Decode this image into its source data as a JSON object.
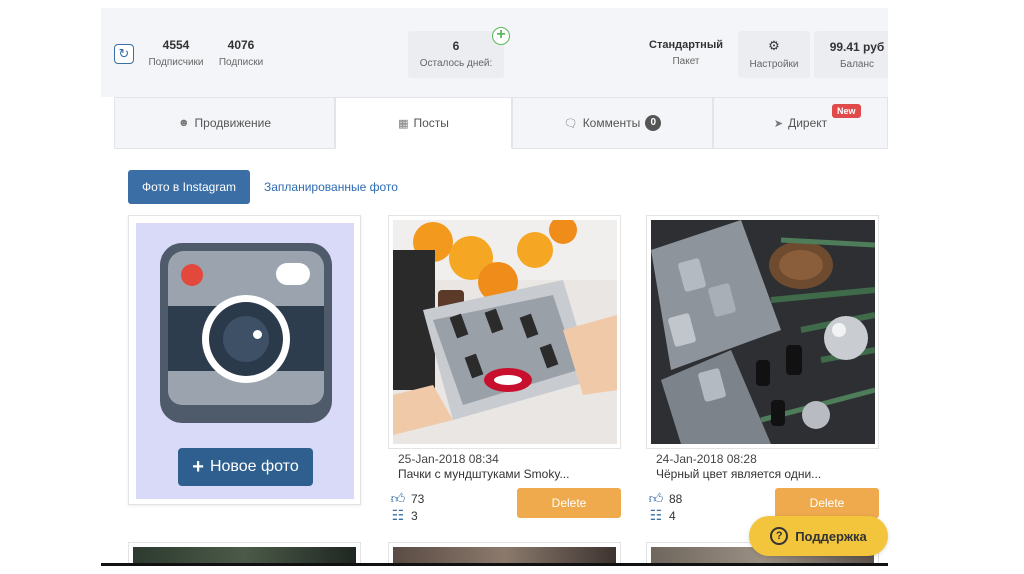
{
  "stats": {
    "subscribers": {
      "value": "4554",
      "label": "Подписчики"
    },
    "following": {
      "value": "4076",
      "label": "Подписки"
    },
    "days_left": {
      "value": "6",
      "label": "Осталось дней:"
    },
    "package": {
      "value": "Стандартный",
      "label": "Пакет"
    },
    "settings": {
      "label": "Настройки"
    },
    "balance": {
      "value": "99.41 руб",
      "label": "Баланс"
    }
  },
  "tabs": [
    {
      "label": "Продвижение",
      "icon": "users-icon"
    },
    {
      "label": "Посты",
      "icon": "grid-icon"
    },
    {
      "label": "Комменты",
      "icon": "comments-icon",
      "count": "0"
    },
    {
      "label": "Директ",
      "icon": "paper-plane-icon",
      "badge": "New"
    }
  ],
  "subtabs": {
    "instagram_photos": "Фото в Instagram",
    "scheduled_photos": "Запланированные фото"
  },
  "new_photo": {
    "label": "Новое фото"
  },
  "posts": [
    {
      "date": "25-Jan-2018 08:34",
      "caption": "Пачки с мундштуками Smoky...",
      "likes": "73",
      "comments": "3",
      "delete_label": "Delete"
    },
    {
      "date": "24-Jan-2018 08:28",
      "caption": "Чёрный цвет является одни...",
      "likes": "88",
      "comments": "4",
      "delete_label": "Delete"
    }
  ],
  "support": {
    "label": "Поддержка"
  },
  "colors": {
    "primary": "#3a6ea5",
    "delete": "#efaa4e",
    "support": "#f2c53d",
    "new_badge": "#e04a4a",
    "plus": "#5cb85c"
  }
}
